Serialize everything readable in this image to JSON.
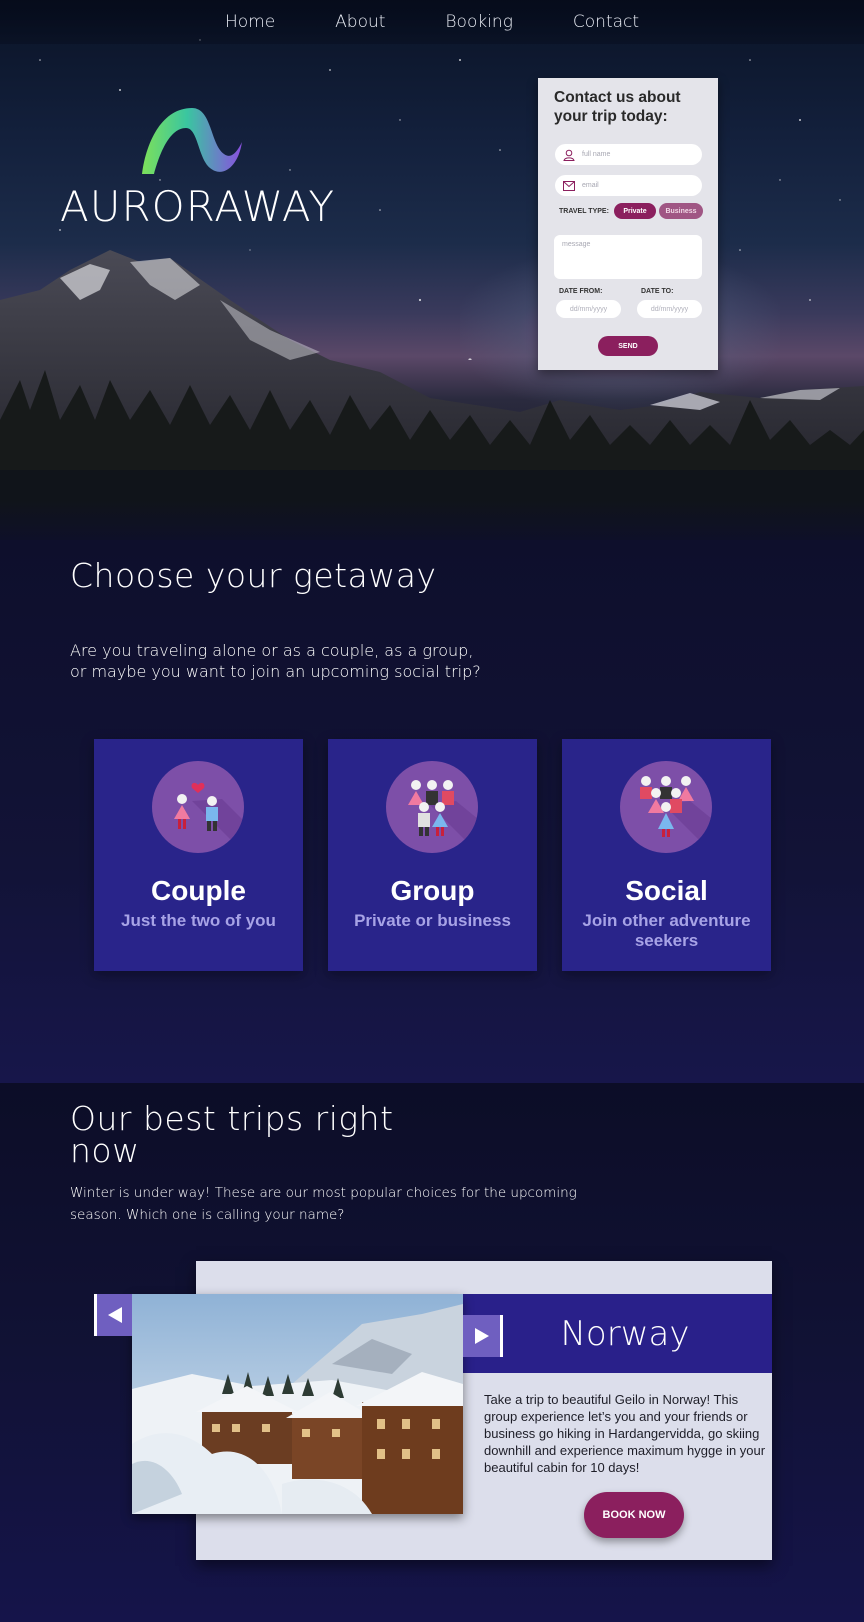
{
  "nav": {
    "items": [
      "Home",
      "About",
      "Booking",
      "Contact"
    ]
  },
  "brand": {
    "name": "AURORAWAY"
  },
  "contact_form": {
    "title": "Contact us about your trip today:",
    "name_placeholder": "full name",
    "email_placeholder": "email",
    "travel_type_label": "TRAVEL TYPE:",
    "travel_types": [
      "Private",
      "Business"
    ],
    "message_placeholder": "message",
    "date_from_label": "DATE FROM:",
    "date_to_label": "DATE TO:",
    "date_placeholder": "dd/mm/yyyy",
    "send_label": "SEND"
  },
  "getaway": {
    "title": "Choose your getaway",
    "subtitle": "Are you traveling alone or as a couple, as a group, or maybe you want to join an upcoming social trip?",
    "cards": [
      {
        "title": "Couple",
        "subtitle": "Just the two of you",
        "icon": "couple-icon"
      },
      {
        "title": "Group",
        "subtitle": "Private or business",
        "icon": "group-icon"
      },
      {
        "title": "Social",
        "subtitle": "Join other adventure seekers",
        "icon": "social-icon"
      }
    ]
  },
  "trips": {
    "title": "Our best trips right now",
    "subtitle": "Winter is under way! These are our most popular choices for the upcoming season. Which one is calling your name?",
    "featured": {
      "name": "Norway",
      "description": "Take a trip to beautiful Geilo in Norway! This group experience let’s you and your friends or business go hiking in Hardangervidda, go skiing downhill and experience maximum hygge in your beautiful cabin for 10 days!",
      "button_label": "BOOK NOW"
    }
  },
  "colors": {
    "accent": "#8b1f5e",
    "card_background": "#29248a",
    "page_background": "#141338",
    "arrow": "#6f5fc0",
    "card_subtitle": "#a7a3e6"
  }
}
